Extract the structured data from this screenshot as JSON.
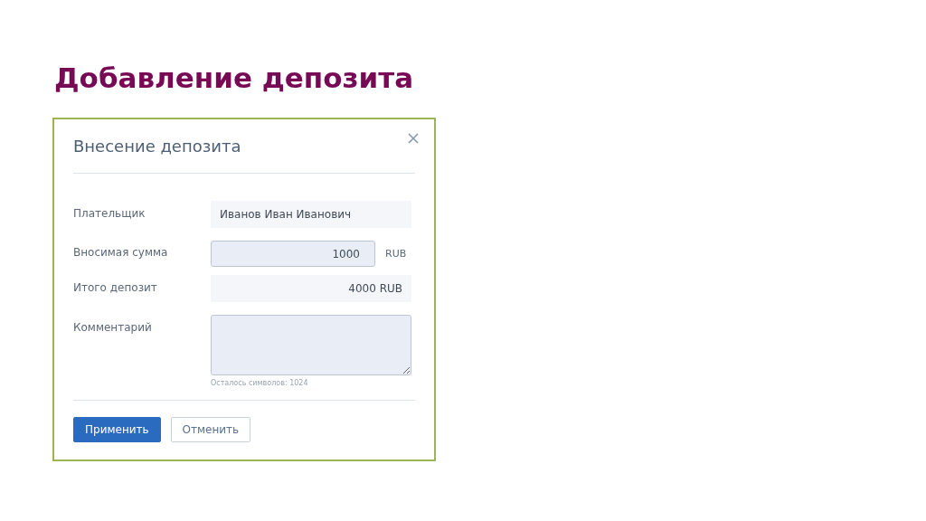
{
  "slide_title": "Добавление депозита",
  "dialog": {
    "title": "Внесение депозита",
    "fields": [
      {
        "kind": "readonly",
        "label": "Плательщик",
        "value": "Иванов Иван Иванович"
      },
      {
        "kind": "input",
        "label": "Вносимая сумма",
        "value": "1000",
        "unit": "RUB"
      },
      {
        "kind": "total",
        "label": "Итого депозит",
        "value": "4000 RUB"
      },
      {
        "kind": "textarea",
        "label": "Комментарий",
        "hint": "Осталось символов: 1024"
      }
    ],
    "buttons": [
      {
        "kind": "primary",
        "label": "Применить"
      },
      {
        "kind": "secondary",
        "label": "Отменить"
      }
    ]
  }
}
